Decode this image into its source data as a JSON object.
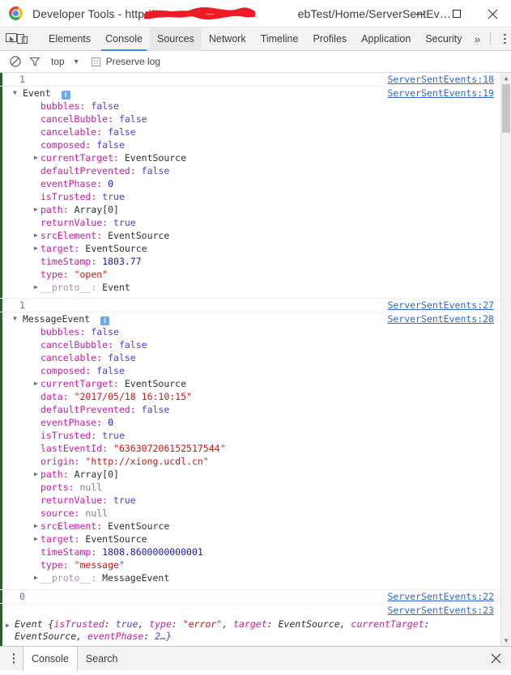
{
  "window": {
    "title_prefix": "Developer Tools - http://",
    "title_suffix": "ebTest/Home/ServerSentEv…",
    "redaction_color": "#ee1c25",
    "minimize_label": "Minimize",
    "maximize_label": "Maximize",
    "close_label": "Close"
  },
  "toolbar": {
    "inspect_icon": "inspect-element-icon",
    "device_icon": "device-toolbar-icon",
    "tabs": [
      {
        "label": "Elements",
        "state": "normal"
      },
      {
        "label": "Console",
        "state": "active"
      },
      {
        "label": "Sources",
        "state": "hovered"
      },
      {
        "label": "Network",
        "state": "normal"
      },
      {
        "label": "Timeline",
        "state": "normal"
      },
      {
        "label": "Profiles",
        "state": "normal"
      },
      {
        "label": "Application",
        "state": "normal"
      },
      {
        "label": "Security",
        "state": "normal"
      }
    ],
    "more_tabs": "»",
    "menu_icon": "vertical-dots-icon"
  },
  "console_bar": {
    "clear_icon": "clear-console-icon",
    "filter_icon": "filter-funnel-icon",
    "context_value": "top",
    "context_caret": "▼",
    "preserve_log_label": "Preserve log",
    "preserve_log_checked": false
  },
  "console": {
    "groups": [
      {
        "count": "1",
        "count_link": "ServerSentEvents:18",
        "object_name": "Event",
        "object_link": "ServerSentEvents:19",
        "info_badge": "i",
        "expanded": true,
        "properties": [
          {
            "indent": false,
            "name": "bubbles",
            "value": "false",
            "kind": "bool"
          },
          {
            "indent": false,
            "name": "cancelBubble",
            "value": "false",
            "kind": "bool"
          },
          {
            "indent": false,
            "name": "cancelable",
            "value": "false",
            "kind": "bool"
          },
          {
            "indent": false,
            "name": "composed",
            "value": "false",
            "kind": "bool"
          },
          {
            "indent": true,
            "name": "currentTarget",
            "value": "EventSource",
            "kind": "obj"
          },
          {
            "indent": false,
            "name": "defaultPrevented",
            "value": "false",
            "kind": "bool"
          },
          {
            "indent": false,
            "name": "eventPhase",
            "value": "0",
            "kind": "num"
          },
          {
            "indent": false,
            "name": "isTrusted",
            "value": "true",
            "kind": "bool"
          },
          {
            "indent": true,
            "name": "path",
            "value": "Array[0]",
            "kind": "obj"
          },
          {
            "indent": false,
            "name": "returnValue",
            "value": "true",
            "kind": "bool"
          },
          {
            "indent": true,
            "name": "srcElement",
            "value": "EventSource",
            "kind": "obj"
          },
          {
            "indent": true,
            "name": "target",
            "value": "EventSource",
            "kind": "obj"
          },
          {
            "indent": false,
            "name": "timeStamp",
            "value": "1803.77",
            "kind": "num"
          },
          {
            "indent": false,
            "name": "type",
            "value": "\"open\"",
            "kind": "str"
          },
          {
            "indent": true,
            "name": "__proto__",
            "value": "Event",
            "kind": "obj",
            "dim": true
          }
        ]
      },
      {
        "count": "1",
        "count_link": "ServerSentEvents:27",
        "object_name": "MessageEvent",
        "object_link": "ServerSentEvents:28",
        "info_badge": "i",
        "expanded": true,
        "properties": [
          {
            "indent": false,
            "name": "bubbles",
            "value": "false",
            "kind": "bool"
          },
          {
            "indent": false,
            "name": "cancelBubble",
            "value": "false",
            "kind": "bool"
          },
          {
            "indent": false,
            "name": "cancelable",
            "value": "false",
            "kind": "bool"
          },
          {
            "indent": false,
            "name": "composed",
            "value": "false",
            "kind": "bool"
          },
          {
            "indent": true,
            "name": "currentTarget",
            "value": "EventSource",
            "kind": "obj"
          },
          {
            "indent": false,
            "name": "data",
            "value": "\"2017/05/18 16:10:15\"",
            "kind": "str"
          },
          {
            "indent": false,
            "name": "defaultPrevented",
            "value": "false",
            "kind": "bool"
          },
          {
            "indent": false,
            "name": "eventPhase",
            "value": "0",
            "kind": "num"
          },
          {
            "indent": false,
            "name": "isTrusted",
            "value": "true",
            "kind": "bool"
          },
          {
            "indent": false,
            "name": "lastEventId",
            "value": "\"636307206152517544\"",
            "kind": "str"
          },
          {
            "indent": false,
            "name": "origin",
            "value": "\"http://xiong.ucdl.cn\"",
            "kind": "str"
          },
          {
            "indent": true,
            "name": "path",
            "value": "Array[0]",
            "kind": "obj"
          },
          {
            "indent": false,
            "name": "ports",
            "value": "null",
            "kind": "null"
          },
          {
            "indent": false,
            "name": "returnValue",
            "value": "true",
            "kind": "bool"
          },
          {
            "indent": false,
            "name": "source",
            "value": "null",
            "kind": "null"
          },
          {
            "indent": true,
            "name": "srcElement",
            "value": "EventSource",
            "kind": "obj"
          },
          {
            "indent": true,
            "name": "target",
            "value": "EventSource",
            "kind": "obj"
          },
          {
            "indent": false,
            "name": "timeStamp",
            "value": "1808.8600000000001",
            "kind": "num"
          },
          {
            "indent": false,
            "name": "type",
            "value": "\"message\"",
            "kind": "str"
          },
          {
            "indent": true,
            "name": "__proto__",
            "value": "MessageEvent",
            "kind": "obj",
            "dim": true
          }
        ]
      }
    ],
    "error_entry": {
      "count": "0",
      "count_link": "ServerSentEvents:22",
      "object_link": "ServerSentEvents:23",
      "summary_prefix": "Event {",
      "k1": "isTrusted",
      "v1": "true",
      "k2": "type",
      "v2": "\"error\"",
      "k3": "target",
      "v3": "EventSource",
      "k4": "currentTarget",
      "v4": "EventSource",
      "k5": "eventPhase",
      "v5": "2…}"
    }
  },
  "drawer": {
    "menu_icon": "vertical-dots-icon",
    "tabs": [
      {
        "label": "Console",
        "state": "active"
      },
      {
        "label": "Search",
        "state": "normal"
      }
    ],
    "close_icon": "close-icon"
  }
}
